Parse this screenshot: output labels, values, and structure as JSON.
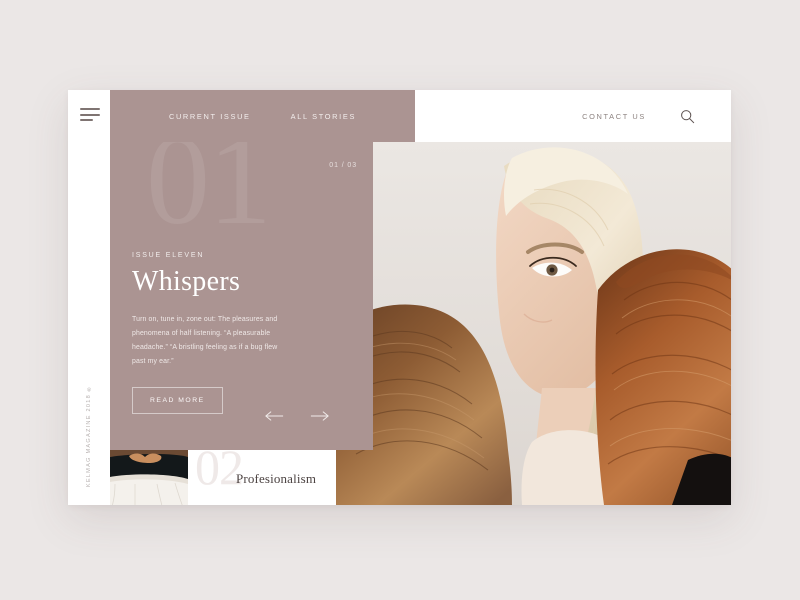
{
  "brand": {
    "vertical_text": "KELMAG MAGAZINE 2018 ®"
  },
  "nav": {
    "menu_icon": "hamburger-icon",
    "links": [
      {
        "label": "CURRENT ISSUE"
      },
      {
        "label": "ALL STORIES"
      }
    ],
    "contact_label": "CONTACT US",
    "search_icon": "search-icon"
  },
  "feature": {
    "counter": "01 / 03",
    "watermark": "01",
    "kicker": "ISSUE ELEVEN",
    "title": "Whispers",
    "excerpt": "Turn on, tune in, zone out: The pleasures and phenomena of half listening. “A pleasurable headache.” “A bristling feeling as if a bug flew past my ear.”",
    "cta_label": "READ MORE",
    "prev_icon": "arrow-left-icon",
    "next_icon": "arrow-right-icon"
  },
  "teaser": {
    "number": "02",
    "title": "Profesionalism",
    "thumb_alt": "person-hands-behind-back-photo"
  },
  "hero": {
    "alt": "three-women-hair-color-photo"
  },
  "colors": {
    "page_bg": "#EBE7E6",
    "card_bg": "#FFFFFF",
    "accent_mauve": "#AB9492",
    "text_dark": "#4C4342",
    "text_muted": "#8D8381"
  }
}
